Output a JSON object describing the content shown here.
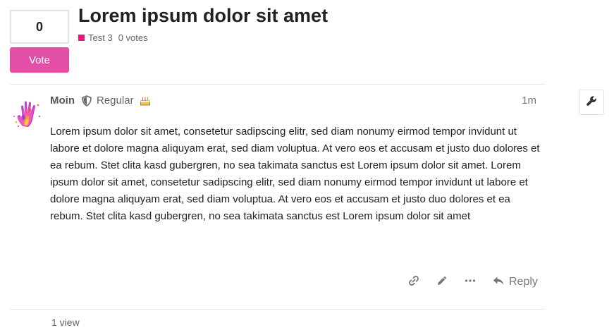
{
  "colors": {
    "accent": "#e34fa6",
    "category": "#e8157b"
  },
  "vote": {
    "count": "0",
    "button_label": "Vote"
  },
  "topic": {
    "title": "Lorem ipsum dolor sit amet",
    "category": "Test 3",
    "votes_text": "0 votes"
  },
  "post": {
    "avatar_icon": "hand-print-avatar",
    "username": "Moin",
    "role_icon": "shield-icon",
    "user_title": "Regular",
    "badge_icon": "cake-icon",
    "date": "1m",
    "admin_icon": "wrench-icon",
    "body": "Lorem ipsum dolor sit amet, consetetur sadipscing elitr, sed diam nonumy eirmod tempor invidunt ut labore et dolore magna aliquyam erat, sed diam voluptua. At vero eos et accusam et justo duo dolores et ea rebum. Stet clita kasd gubergren, no sea takimata sanctus est Lorem ipsum dolor sit amet. Lorem ipsum dolor sit amet, consetetur sadipscing elitr, sed diam nonumy eirmod tempor invidunt ut labore et dolore magna aliquyam erat, sed diam voluptua. At vero eos et accusam et justo duo dolores et ea rebum. Stet clita kasd gubergren, no sea takimata sanctus est Lorem ipsum dolor sit amet",
    "actions": {
      "link_icon": "link-icon",
      "edit_icon": "pencil-icon",
      "more_icon": "more-icon",
      "reply_icon": "reply-icon",
      "reply_label": "Reply"
    }
  },
  "footer": {
    "views": "1 view"
  }
}
